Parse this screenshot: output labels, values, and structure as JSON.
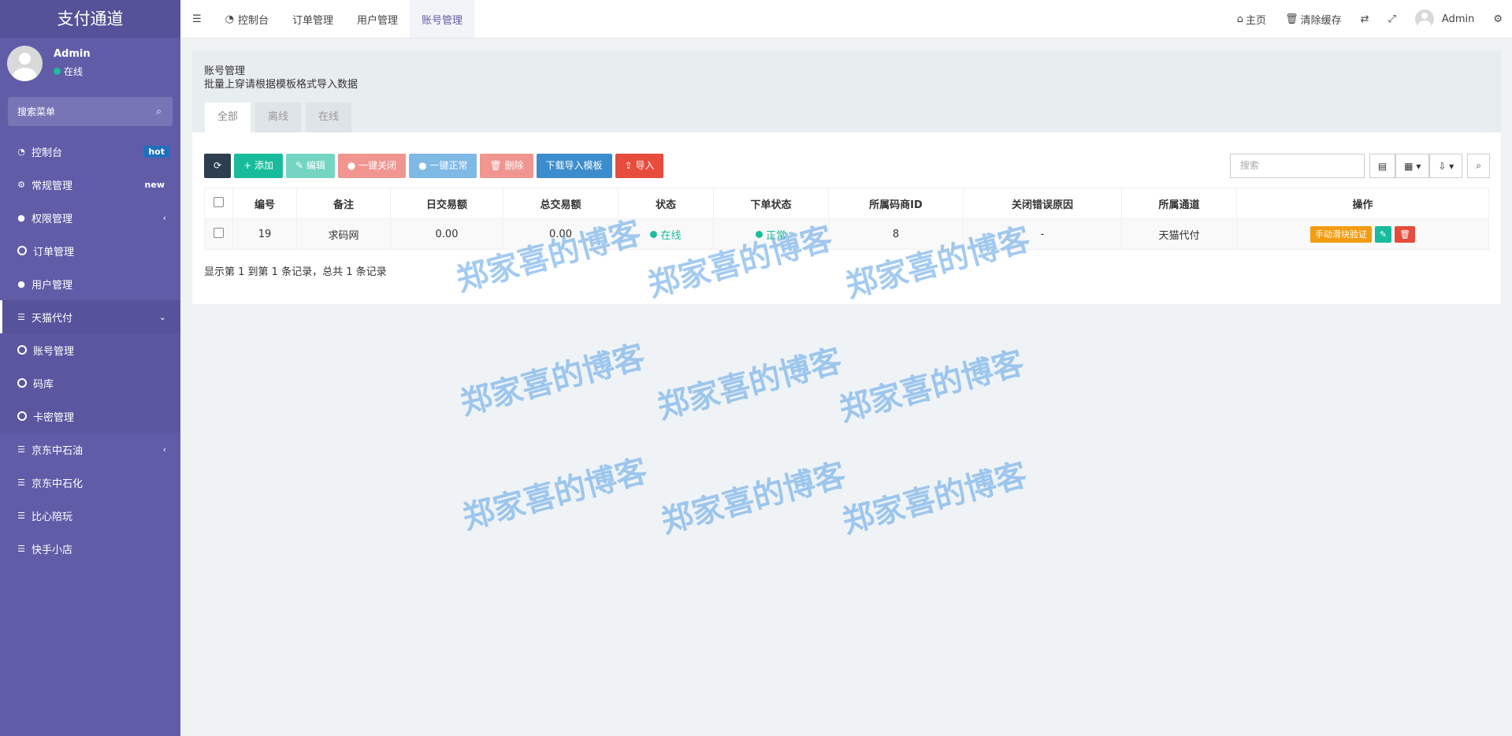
{
  "sidebar": {
    "brand": "支付通道",
    "user": {
      "name": "Admin",
      "status": "在线"
    },
    "search_placeholder": "搜索菜单",
    "items": [
      {
        "label": "控制台",
        "badge": "hot"
      },
      {
        "label": "常规管理",
        "badge": "new"
      },
      {
        "label": "权限管理",
        "arrow": "‹"
      },
      {
        "label": "订单管理"
      },
      {
        "label": "用户管理"
      },
      {
        "label": "天猫代付",
        "arrow": "⌄"
      },
      {
        "label": "账号管理"
      },
      {
        "label": "码库"
      },
      {
        "label": "卡密管理"
      },
      {
        "label": "京东中石油",
        "arrow": "‹"
      },
      {
        "label": "京东中石化"
      },
      {
        "label": "比心陪玩"
      },
      {
        "label": "快手小店"
      }
    ]
  },
  "topbar": {
    "nav": [
      "控制台",
      "订单管理",
      "用户管理",
      "账号管理"
    ],
    "home": "主页",
    "clear_cache": "清除缓存",
    "user": "Admin"
  },
  "panel": {
    "title": "账号管理",
    "subtitle": "批量上穿请根据模板格式导入数据",
    "tabs": [
      "全部",
      "离线",
      "在线"
    ]
  },
  "toolbar": {
    "add": "添加",
    "edit": "编辑",
    "close_all": "一键关闭",
    "normal_all": "一键正常",
    "delete": "删除",
    "download_template": "下载导入模板",
    "import": "导入",
    "search_placeholder": "搜索"
  },
  "table": {
    "headers": [
      "编号",
      "备注",
      "日交易额",
      "总交易额",
      "状态",
      "下单状态",
      "所属码商ID",
      "关闭错误原因",
      "所属通道",
      "操作"
    ],
    "rows": [
      {
        "id": "19",
        "note": "求码网",
        "daily": "0.00",
        "total": "0.00",
        "status": "在线",
        "order_status": "正常",
        "merchant_id": "8",
        "error": "-",
        "channel": "天猫代付",
        "action": "手动滑块验证"
      }
    ]
  },
  "pagination_info": "显示第 1 到第 1 条记录，总共 1 条记录",
  "watermark": "郑家喜的博客",
  "colors": {
    "sidebar": "#605ca8",
    "accent": "#19be9b",
    "danger": "#e74c3c",
    "warning": "#f39c12"
  }
}
